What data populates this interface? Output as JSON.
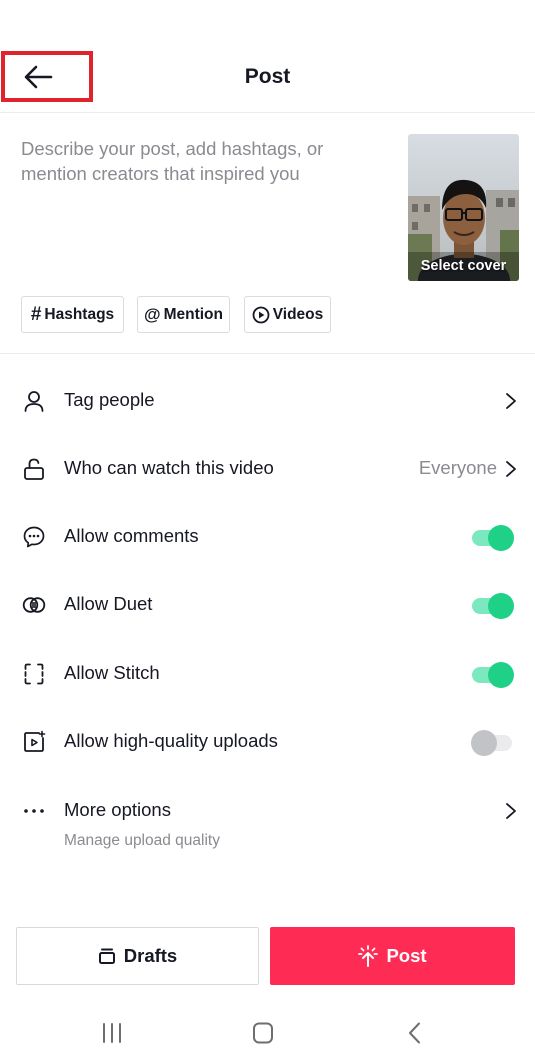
{
  "header": {
    "title": "Post"
  },
  "caption": {
    "placeholder": "Describe your post, add hashtags, or mention creators that inspired you"
  },
  "cover": {
    "label": "Select cover"
  },
  "chips": [
    {
      "symbol": "#",
      "label": "Hashtags",
      "icon": "hashtag-icon"
    },
    {
      "symbol": "@",
      "label": "Mention",
      "icon": "at-icon"
    },
    {
      "symbol": "",
      "label": "Videos",
      "icon": "play-circle-icon"
    }
  ],
  "settings": [
    {
      "label": "Tag people",
      "icon": "person-icon",
      "control": "chevron"
    },
    {
      "label": "Who can watch this video",
      "value": "Everyone",
      "icon": "lock-open-icon",
      "control": "chevron"
    },
    {
      "label": "Allow comments",
      "icon": "comment-icon",
      "control": "toggle",
      "enabled": true
    },
    {
      "label": "Allow Duet",
      "icon": "duet-icon",
      "control": "toggle",
      "enabled": true
    },
    {
      "label": "Allow Stitch",
      "icon": "stitch-icon",
      "control": "toggle",
      "enabled": true
    },
    {
      "label": "Allow high-quality uploads",
      "icon": "hq-upload-icon",
      "control": "toggle",
      "enabled": false
    },
    {
      "label": "More options",
      "sublabel": "Manage upload quality",
      "icon": "more-dots-icon",
      "control": "chevron"
    }
  ],
  "footer": {
    "drafts_label": "Drafts",
    "post_label": "Post"
  },
  "colors": {
    "accent": "#fe2c55",
    "toggle_on": "#1fd087",
    "highlight_box": "#e0242e",
    "muted_text": "#8a8b91"
  }
}
